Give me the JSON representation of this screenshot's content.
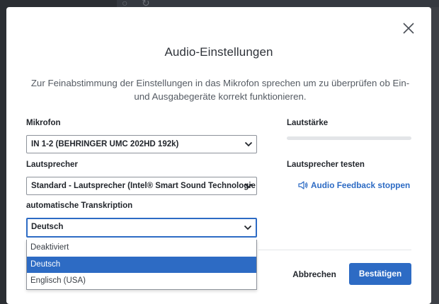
{
  "dialog": {
    "title": "Audio-Einstellungen",
    "description": "Zur Feinabstimmung der Einstellungen in das Mikrofon sprechen um zu überprüfen ob Ein- und Ausgabegeräte korrekt funktionieren."
  },
  "microphone": {
    "label": "Mikrofon",
    "value": "IN 1-2 (BEHRINGER UMC 202HD 192k)"
  },
  "speaker": {
    "label": "Lautsprecher",
    "value": "Standard - Lautsprecher (Intel® Smart Sound Technologie"
  },
  "transcription": {
    "label": "automatische Transkription",
    "value": "Deutsch",
    "options": [
      "Deaktiviert",
      "Deutsch",
      "Englisch (USA)"
    ],
    "selected_index": 1
  },
  "volume": {
    "label": "Lautstärke",
    "level": 0
  },
  "speaker_test": {
    "label": "Lautsprecher testen",
    "link_text": "Audio Feedback stoppen"
  },
  "actions": {
    "cancel": "Abbrechen",
    "confirm": "Bestätigen"
  },
  "icons": {
    "close": "close-icon",
    "chevron": "chevron-down-icon",
    "speaker": "speaker-icon"
  },
  "colors": {
    "accent": "#2d6bc4",
    "backdrop": "#3d4046"
  }
}
